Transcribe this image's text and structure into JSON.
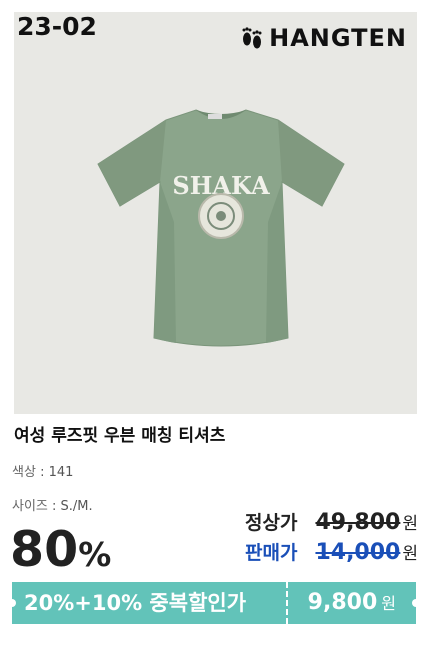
{
  "product_card": {
    "code": "23-02",
    "brand": "HANGTEN",
    "name": "여성 루즈핏 우븐 매칭 티셔츠",
    "color_label": "색상",
    "color_value": "141",
    "size_label": "사이즈",
    "size_value": "S./M.",
    "discount_value": "80",
    "discount_unit": "%",
    "regular_price_label": "정상가",
    "regular_price": "49,800",
    "sale_price_label": "판매가",
    "sale_price": "14,000",
    "currency_unit": "원",
    "deal_label": "20%+10% 중복할인가",
    "deal_price": "9,800",
    "print_text": "SHAKA",
    "icons": [
      "footprints-icon",
      "tshirt-image"
    ]
  },
  "colors": {
    "accent": "#62c3b9",
    "sale": "#1a4fb8",
    "text": "#222222",
    "shirt": "#8aa38a"
  }
}
